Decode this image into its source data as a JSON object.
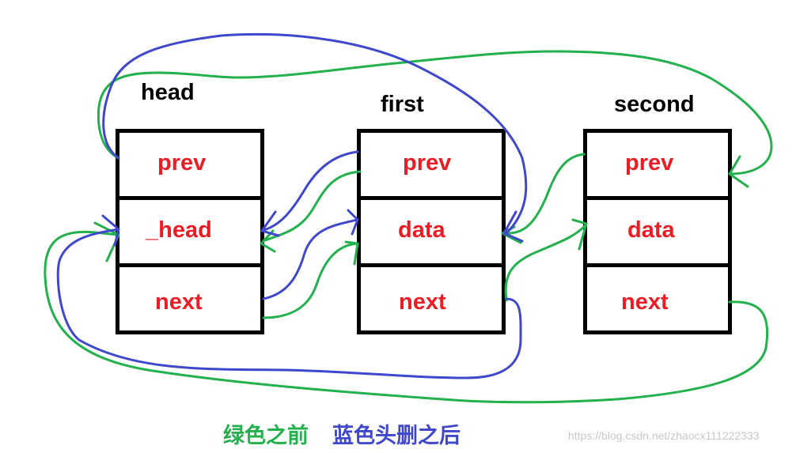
{
  "nodes": [
    {
      "name": "head",
      "fields": [
        "prev",
        "_head",
        "next"
      ]
    },
    {
      "name": "first",
      "fields": [
        "prev",
        "data",
        "next"
      ]
    },
    {
      "name": "second",
      "fields": [
        "prev",
        "data",
        "next"
      ]
    }
  ],
  "legend": {
    "green_text": "绿色之前",
    "blue_text": "蓝色头删之后"
  },
  "colors": {
    "green": "#22b14c",
    "blue": "#3f48cc",
    "field_text": "#ec1c24",
    "box": "#000000"
  },
  "watermark": "https://blog.csdn.net/zhaocx111222333"
}
